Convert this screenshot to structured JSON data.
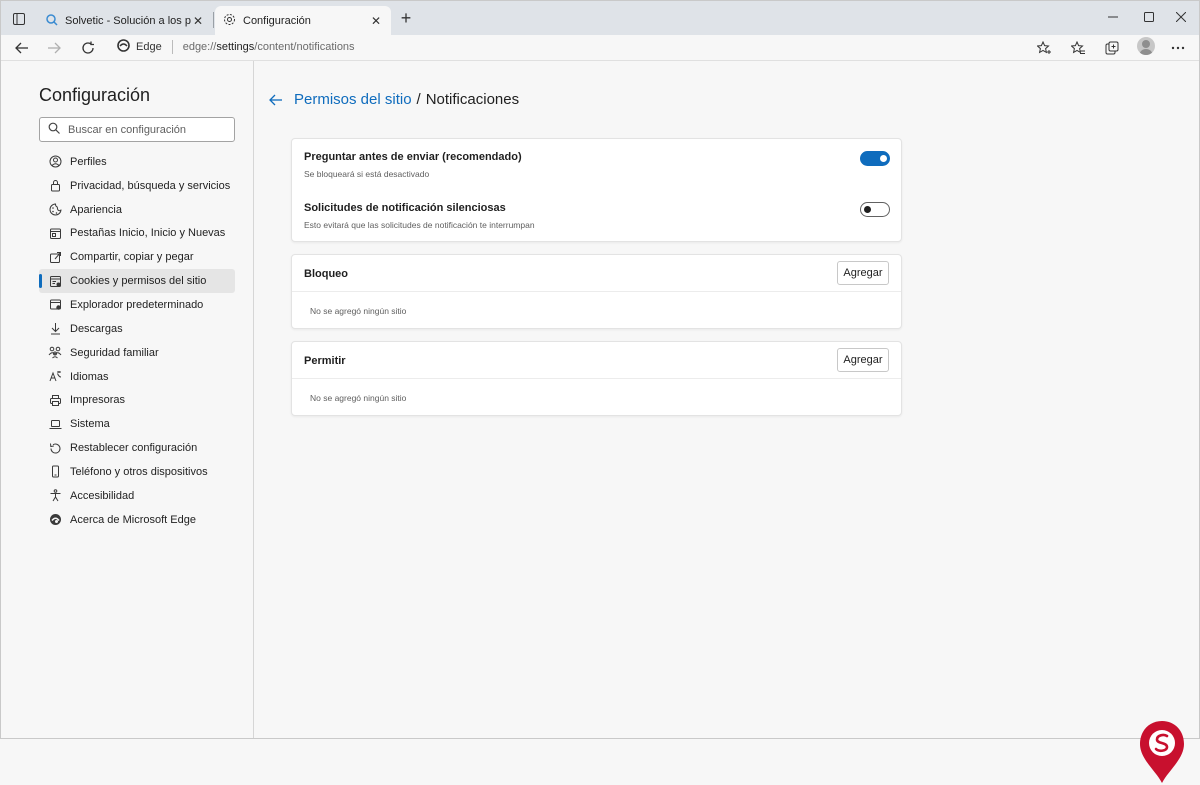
{
  "browser": {
    "tabs": [
      {
        "title": "Solvetic - Solución a los problem",
        "active": false,
        "icon": "search-favicon-icon"
      },
      {
        "title": "Configuración",
        "active": true,
        "icon": "gear-icon"
      }
    ],
    "address": {
      "site_label": "Edge",
      "url_prefix": "edge://",
      "url_host": "settings",
      "url_path": "/content/notifications"
    }
  },
  "sidebar": {
    "title": "Configuración",
    "search_placeholder": "Buscar en configuración",
    "items": [
      {
        "label": "Perfiles",
        "icon": "profile-icon"
      },
      {
        "label": "Privacidad, búsqueda y servicios",
        "icon": "lock-icon"
      },
      {
        "label": "Apariencia",
        "icon": "appearance-icon"
      },
      {
        "label": "Pestañas Inicio, Inicio y Nuevas",
        "icon": "home-tabs-icon"
      },
      {
        "label": "Compartir, copiar y pegar",
        "icon": "share-icon"
      },
      {
        "label": "Cookies y permisos del sitio",
        "icon": "cookies-icon",
        "active": true
      },
      {
        "label": "Explorador predeterminado",
        "icon": "browser-icon"
      },
      {
        "label": "Descargas",
        "icon": "download-icon"
      },
      {
        "label": "Seguridad familiar",
        "icon": "family-icon"
      },
      {
        "label": "Idiomas",
        "icon": "language-icon"
      },
      {
        "label": "Impresoras",
        "icon": "printer-icon"
      },
      {
        "label": "Sistema",
        "icon": "laptop-icon"
      },
      {
        "label": "Restablecer configuración",
        "icon": "reset-icon"
      },
      {
        "label": "Teléfono y otros dispositivos",
        "icon": "phone-icon"
      },
      {
        "label": "Accesibilidad",
        "icon": "accessibility-icon"
      },
      {
        "label": "Acerca de Microsoft Edge",
        "icon": "edge-logo-icon"
      }
    ]
  },
  "main": {
    "breadcrumb_parent": "Permisos del sitio",
    "breadcrumb_sep": "/",
    "breadcrumb_current": "Notificaciones",
    "settings": [
      {
        "title": "Preguntar antes de enviar (recomendado)",
        "desc": "Se bloqueará si está desactivado",
        "enabled": true
      },
      {
        "title": "Solicitudes de notificación silenciosas",
        "desc": "Esto evitará que las solicitudes de notificación te interrumpan",
        "enabled": false
      }
    ],
    "block": {
      "title": "Bloqueo",
      "button": "Agregar",
      "empty": "No se agregó ningún sitio"
    },
    "allow": {
      "title": "Permitir",
      "button": "Agregar",
      "empty": "No se agregó ningún sitio"
    }
  },
  "colors": {
    "accent": "#0f6cbd",
    "logo": "#c8102e"
  }
}
